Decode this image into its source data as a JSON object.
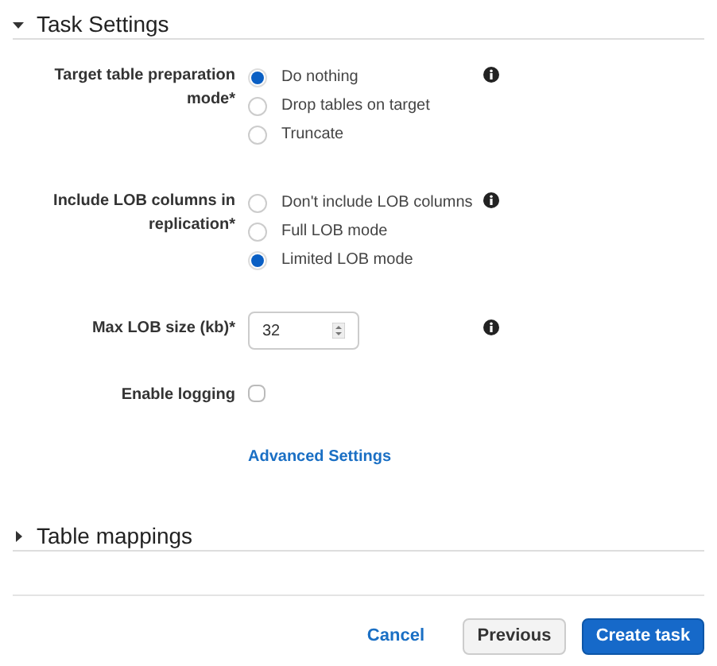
{
  "sections": [
    {
      "title": "Task Settings",
      "expanded": true
    },
    {
      "title": "Table mappings",
      "expanded": false
    }
  ],
  "fields": [
    {
      "kind": "radio",
      "label": "Target table preparation mode*",
      "info": true,
      "options": [
        {
          "label": "Do nothing",
          "selected": true
        },
        {
          "label": "Drop tables on target",
          "selected": false
        },
        {
          "label": "Truncate",
          "selected": false
        }
      ]
    },
    {
      "kind": "radio",
      "label": "Include LOB columns in replication*",
      "info": true,
      "options": [
        {
          "label": "Don't include LOB columns",
          "selected": false
        },
        {
          "label": "Full LOB mode",
          "selected": false
        },
        {
          "label": "Limited LOB mode",
          "selected": true
        }
      ]
    },
    {
      "kind": "number",
      "label": "Max LOB size (kb)*",
      "value": "32",
      "info": true
    },
    {
      "kind": "checkbox",
      "label": "Enable logging",
      "checked": false,
      "info": false
    }
  ],
  "advanced_link": "Advanced Settings",
  "buttons": [
    {
      "label": "Cancel"
    },
    {
      "label": "Previous"
    },
    {
      "label": "Create task"
    }
  ]
}
